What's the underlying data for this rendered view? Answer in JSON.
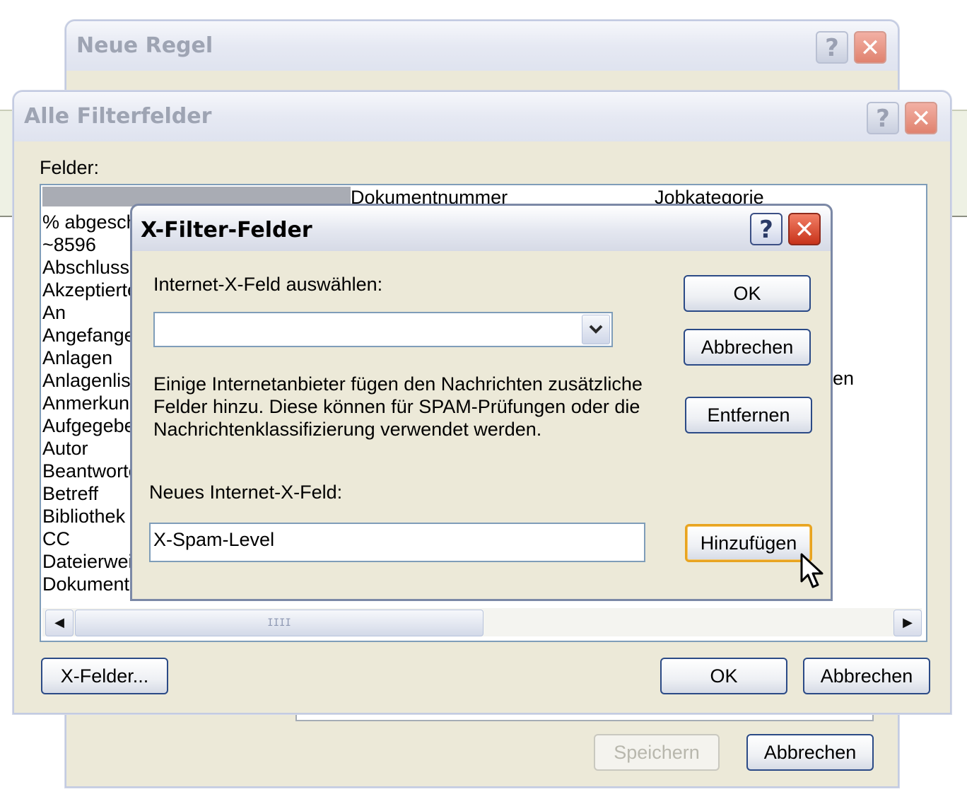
{
  "neue_regel": {
    "title": "Neue Regel",
    "save_label": "Speichern",
    "cancel_label": "Abbrechen"
  },
  "alle_filterfelder": {
    "title": "Alle Filterfelder",
    "fields_label": "Felder:",
    "col2_header": "Dokumentnummer",
    "col3_header": "Jobkategorie",
    "col3_partial": "en",
    "items": [
      "% abgesch",
      "~8596",
      "Abschluss",
      "Akzeptierte",
      "An",
      "Angefange",
      "Anlagen",
      "Anlagenlist",
      "Anmerkung",
      "Aufgegebe",
      "Autor",
      "Beantworte",
      "Betreff",
      "Bibliothek",
      "CC",
      "Dateierwei",
      "Dokument"
    ],
    "xfields_label": "X-Felder...",
    "ok_label": "OK",
    "cancel_label": "Abbrechen"
  },
  "x_filter": {
    "title": "X-Filter-Felder",
    "select_label": "Internet-X-Feld auswählen:",
    "select_value": "",
    "description_lines": [
      "Einige Internetanbieter fügen den Nachrichten zusätzliche",
      "Felder hinzu. Diese können für SPAM-Prüfungen oder die",
      "Nachrichtenklassifizierung verwendet werden."
    ],
    "new_label": "Neues Internet-X-Feld:",
    "new_value": "X-Spam-Level",
    "ok_label": "OK",
    "cancel_label": "Abbrechen",
    "remove_label": "Entfernen",
    "add_label": "Hinzufügen"
  },
  "icons": {
    "help": "?",
    "close": "✕",
    "dropdown": "chevron-down-icon",
    "scroll_left": "◀",
    "scroll_right": "▶",
    "grip": "IIII"
  }
}
